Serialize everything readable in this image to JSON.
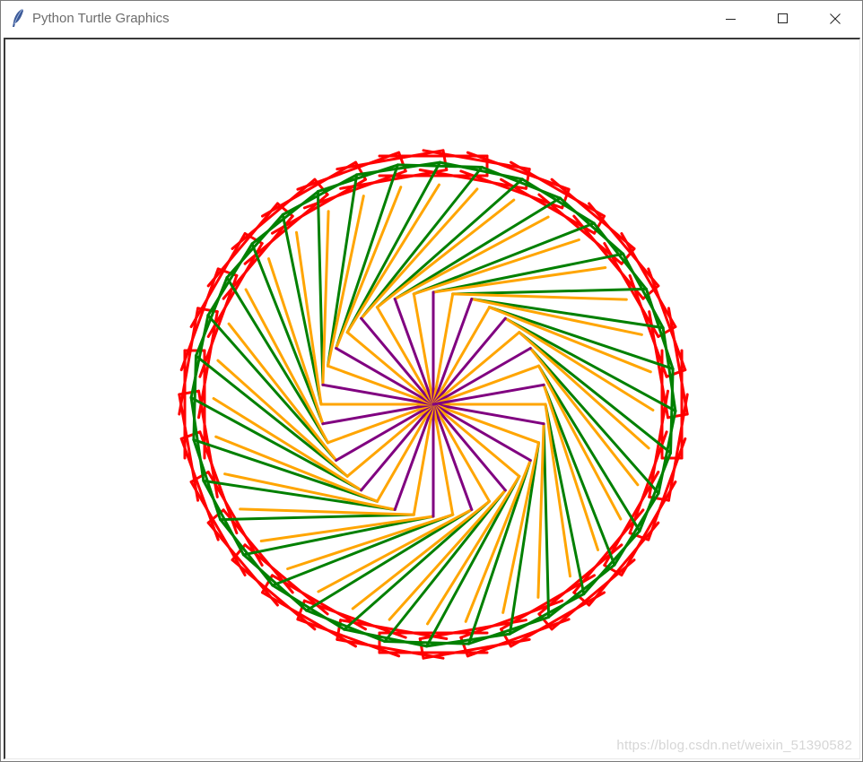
{
  "window": {
    "title": "Python Turtle Graphics",
    "app_icon": "feather-icon",
    "controls": {
      "minimize_icon": "minimize-icon",
      "maximize_icon": "maximize-icon",
      "close_icon": "close-icon"
    }
  },
  "canvas": {
    "background": "#ffffff",
    "drawing": "turtle-spirograph",
    "colors": {
      "outer_squares": "#ff0000",
      "middle_squares": "#008000",
      "spokes_light": "#ffa500",
      "spokes_dark": "#800080"
    },
    "watermark": "https://blog.csdn.net/weixin_51390582"
  }
}
